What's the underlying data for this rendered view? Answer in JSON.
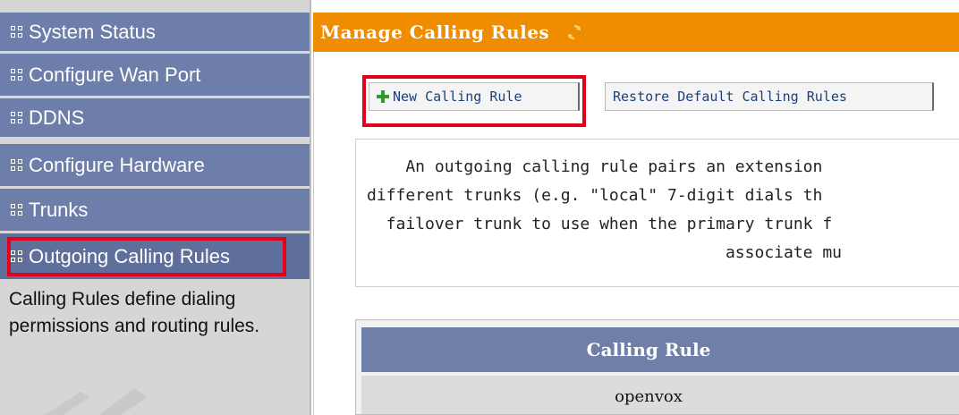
{
  "sidebar": {
    "items": [
      {
        "label": "System Status"
      },
      {
        "label": "Configure Wan Port"
      },
      {
        "label": "DDNS"
      },
      {
        "label": "Configure Hardware"
      },
      {
        "label": "Trunks"
      },
      {
        "label": "Outgoing Calling Rules"
      }
    ],
    "description": "Calling Rules define dialing permissions and routing rules."
  },
  "header": {
    "title": "Manage Calling Rules",
    "accent_color": "#f08c00"
  },
  "toolbar": {
    "new_rule_label": "New Calling Rule",
    "restore_label": "Restore Default Calling Rules"
  },
  "info": {
    "lines": [
      "    An outgoing calling rule pairs an extension",
      "different trunks (e.g. \"local\" 7-digit dials th",
      "  failover trunk to use when the primary trunk f",
      "                                     associate mu"
    ]
  },
  "table": {
    "header": "Calling Rule",
    "rows": [
      {
        "name": "openvox"
      }
    ]
  }
}
